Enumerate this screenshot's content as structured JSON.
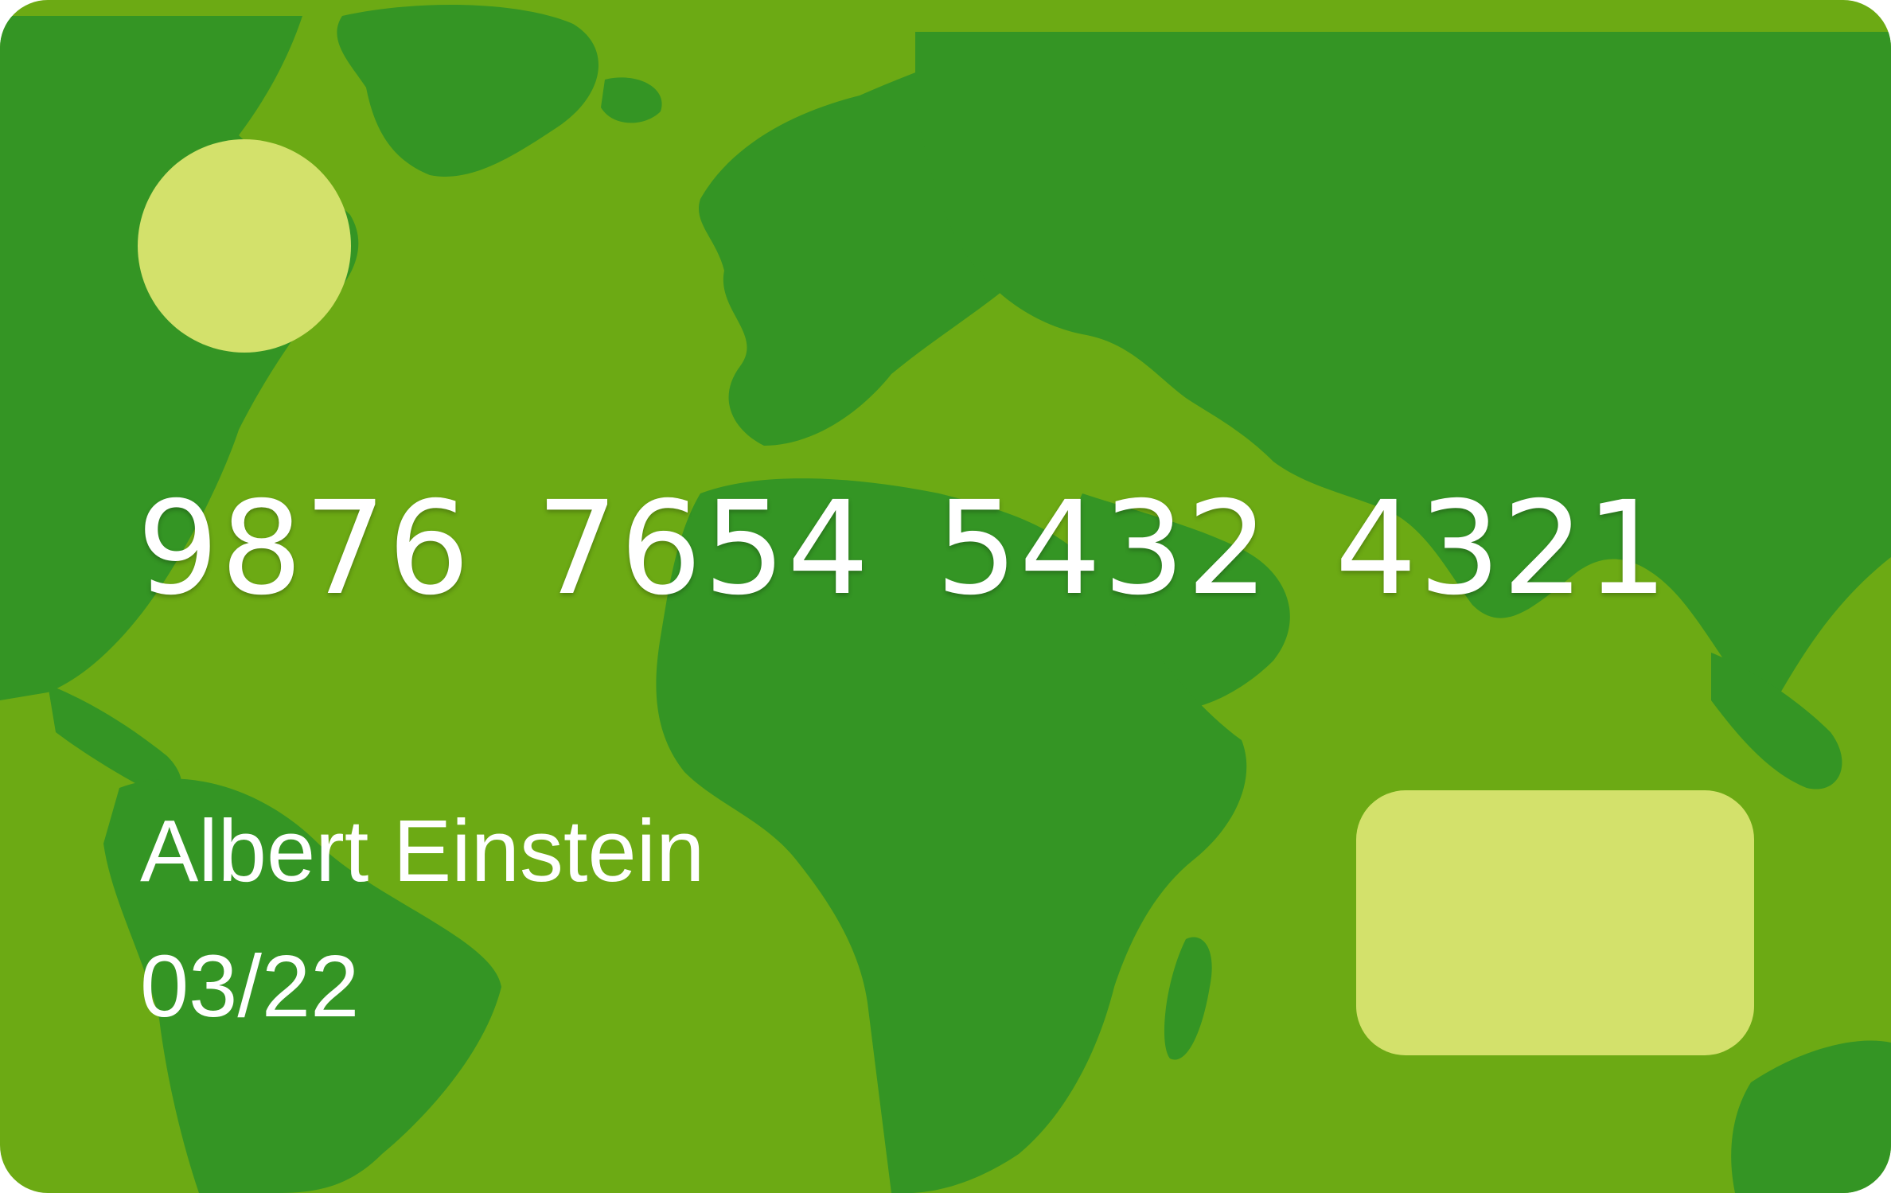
{
  "card": {
    "number_groups": [
      "9876",
      "7654",
      "5432",
      "4321"
    ],
    "holder_name": "Albert Einstein",
    "expiry": "03/22"
  },
  "colors": {
    "ocean": "#6caa14",
    "land": "#349524",
    "accent": "#d3e16b",
    "text": "#ffffff"
  },
  "icons": {
    "logo": "circle-logo-icon",
    "chip": "card-chip-icon",
    "background": "world-map-icon"
  }
}
